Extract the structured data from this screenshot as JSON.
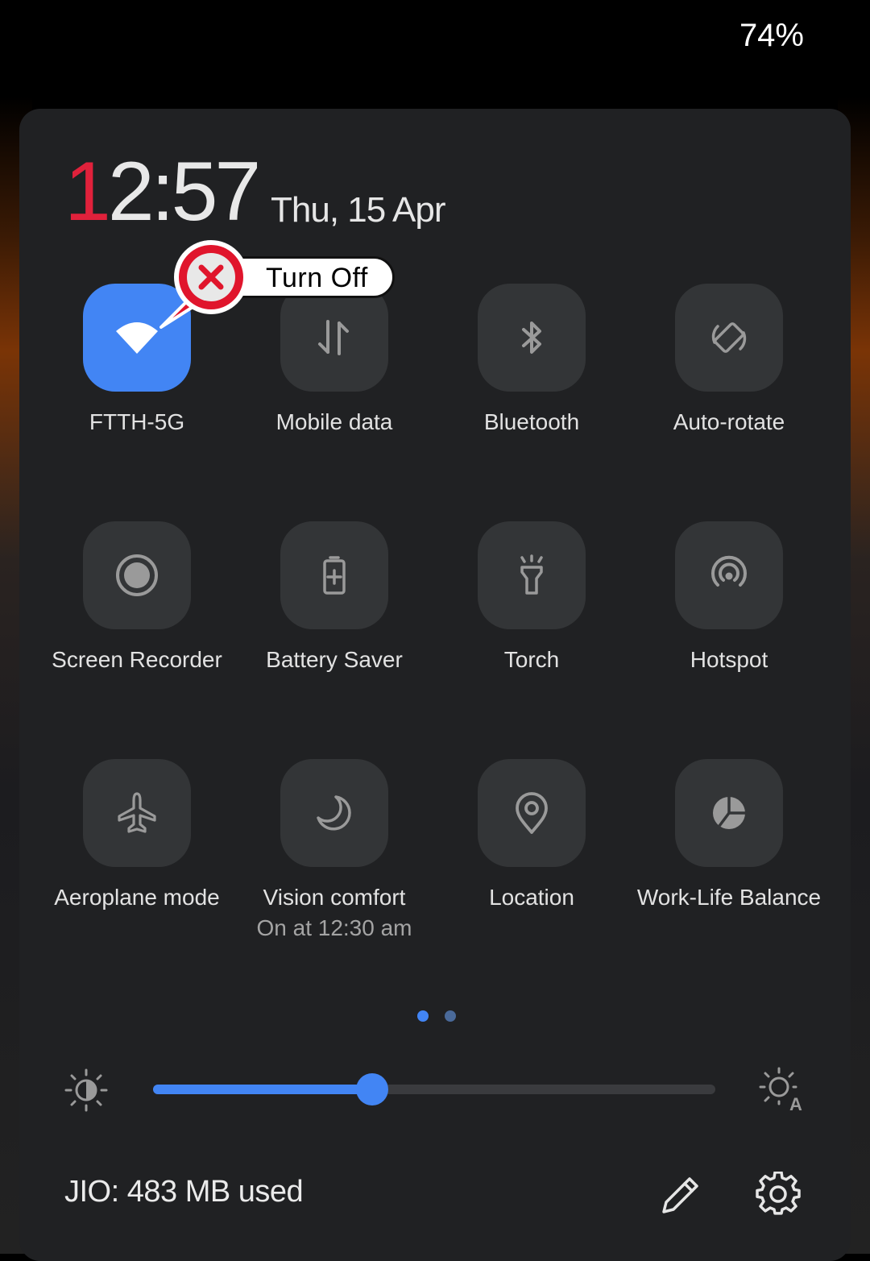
{
  "status_bar": {
    "battery": "74%"
  },
  "header": {
    "clock_first_digit": "1",
    "clock_rest": "2:57",
    "date": "Thu, 15 Apr"
  },
  "callout": {
    "text": "Turn Off",
    "icon": "red-x-marker-icon"
  },
  "tiles": [
    {
      "label": "FTTH-5G",
      "icon": "wifi-icon",
      "active": true
    },
    {
      "label": "Mobile data",
      "icon": "mobile-data-icon",
      "active": false
    },
    {
      "label": "Bluetooth",
      "icon": "bluetooth-icon",
      "active": false
    },
    {
      "label": "Auto-rotate",
      "icon": "auto-rotate-icon",
      "active": false
    },
    {
      "label": "Screen Recorder",
      "icon": "screen-recorder-icon",
      "active": false
    },
    {
      "label": "Battery Saver",
      "icon": "battery-saver-icon",
      "active": false
    },
    {
      "label": "Torch",
      "icon": "torch-icon",
      "active": false
    },
    {
      "label": "Hotspot",
      "icon": "hotspot-icon",
      "active": false
    },
    {
      "label": "Aeroplane mode",
      "icon": "airplane-icon",
      "active": false
    },
    {
      "label": "Vision comfort",
      "sublabel": "On at 12:30 am",
      "icon": "moon-icon",
      "active": false
    },
    {
      "label": "Location",
      "icon": "location-icon",
      "active": false
    },
    {
      "label": "Work-Life Balance",
      "icon": "work-life-balance-icon",
      "active": false
    }
  ],
  "pager": {
    "current_page": 1,
    "total_pages": 2
  },
  "brightness": {
    "level": 0.39
  },
  "footer": {
    "data_usage": "JIO: 483 MB used",
    "edit_icon": "pencil-icon",
    "settings_icon": "gear-icon"
  },
  "colors": {
    "accent": "#4285f4",
    "clock_accent": "#e0213b",
    "panel": "#202123",
    "tile_off": "#333537"
  }
}
